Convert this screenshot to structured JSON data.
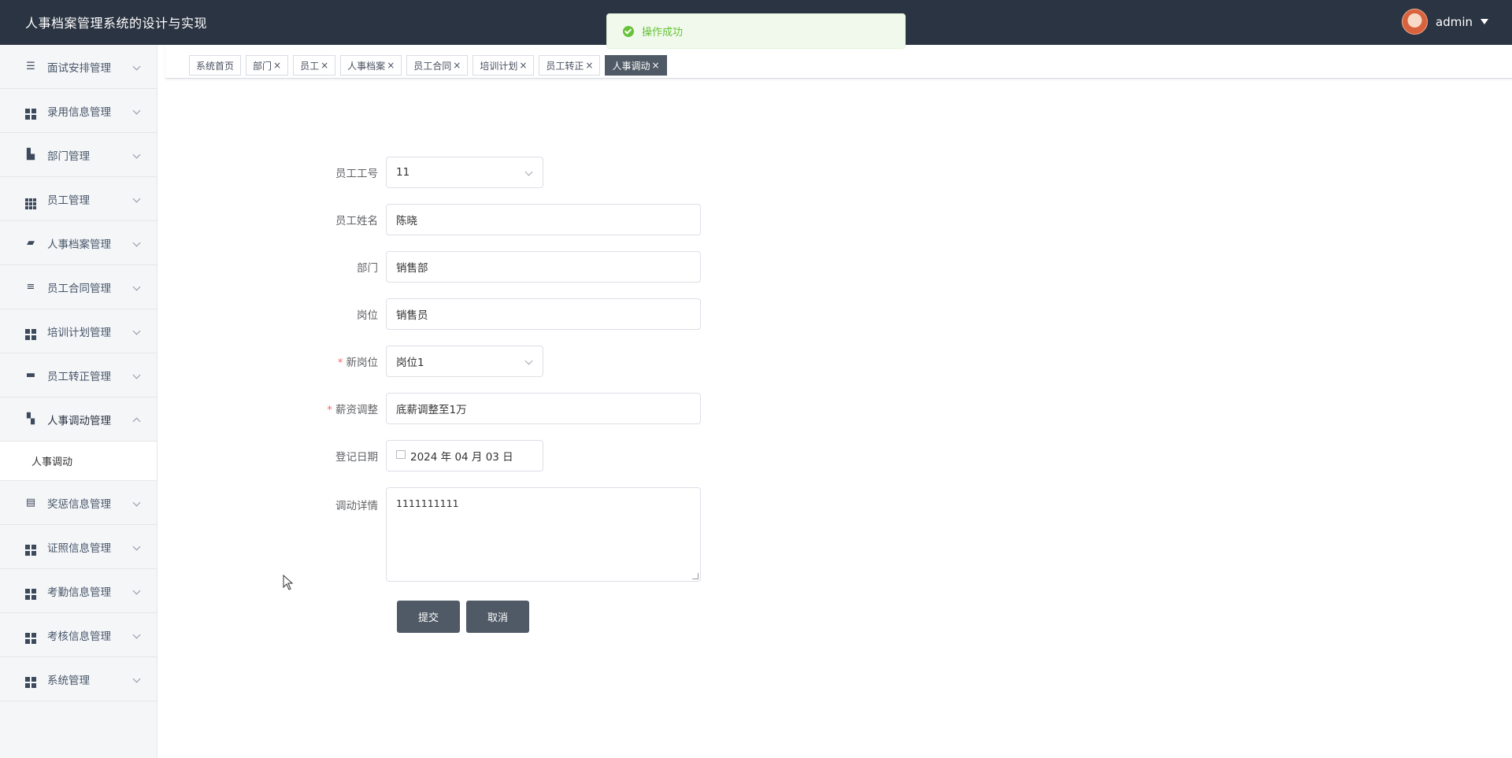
{
  "app": {
    "title": "人事档案管理系统的设计与实现"
  },
  "user": {
    "name": "admin"
  },
  "toast": {
    "message": "操作成功",
    "color": "#67c23a"
  },
  "sidebar": {
    "items": [
      {
        "label": "面试安排管理",
        "icon": "list-icon"
      },
      {
        "label": "录用信息管理",
        "icon": "grid-icon"
      },
      {
        "label": "部门管理",
        "icon": "chart-icon"
      },
      {
        "label": "员工管理",
        "icon": "grid9-icon"
      },
      {
        "label": "人事档案管理",
        "icon": "briefcase-icon"
      },
      {
        "label": "员工合同管理",
        "icon": "sliders-icon"
      },
      {
        "label": "培训计划管理",
        "icon": "grid-icon"
      },
      {
        "label": "员工转正管理",
        "icon": "chat-icon"
      },
      {
        "label": "人事调动管理",
        "icon": "ticket-icon",
        "open": true
      },
      {
        "label": "奖惩信息管理",
        "icon": "clipboard-icon"
      },
      {
        "label": "证照信息管理",
        "icon": "grid-icon"
      },
      {
        "label": "考勤信息管理",
        "icon": "grid-icon"
      },
      {
        "label": "考核信息管理",
        "icon": "grid-icon"
      },
      {
        "label": "系统管理",
        "icon": "grid-icon"
      }
    ],
    "submenu": {
      "label": "人事调动"
    }
  },
  "tabs": [
    {
      "label": "系统首页",
      "closable": false
    },
    {
      "label": "部门",
      "closable": true
    },
    {
      "label": "员工",
      "closable": true
    },
    {
      "label": "人事档案",
      "closable": true
    },
    {
      "label": "员工合同",
      "closable": true
    },
    {
      "label": "培训计划",
      "closable": true
    },
    {
      "label": "员工转正",
      "closable": true
    },
    {
      "label": "人事调动",
      "closable": true,
      "active": true
    }
  ],
  "tab_close_glyph": "×",
  "form": {
    "employee_no": {
      "label": "员工工号",
      "value": "11"
    },
    "employee_name": {
      "label": "员工姓名",
      "value": "陈晓"
    },
    "department": {
      "label": "部门",
      "value": "销售部"
    },
    "position": {
      "label": "岗位",
      "value": "销售员"
    },
    "new_position": {
      "label": "新岗位",
      "value": "岗位1",
      "required": "*"
    },
    "salary_adjust": {
      "label": "薪资调整",
      "value": "底薪调整至1万",
      "required": "*"
    },
    "register_date": {
      "label": "登记日期",
      "value": "2024 年 04 月 03 日"
    },
    "transfer_detail": {
      "label": "调动详情",
      "value": "1111111111"
    },
    "submit_label": "提交",
    "cancel_label": "取消"
  }
}
